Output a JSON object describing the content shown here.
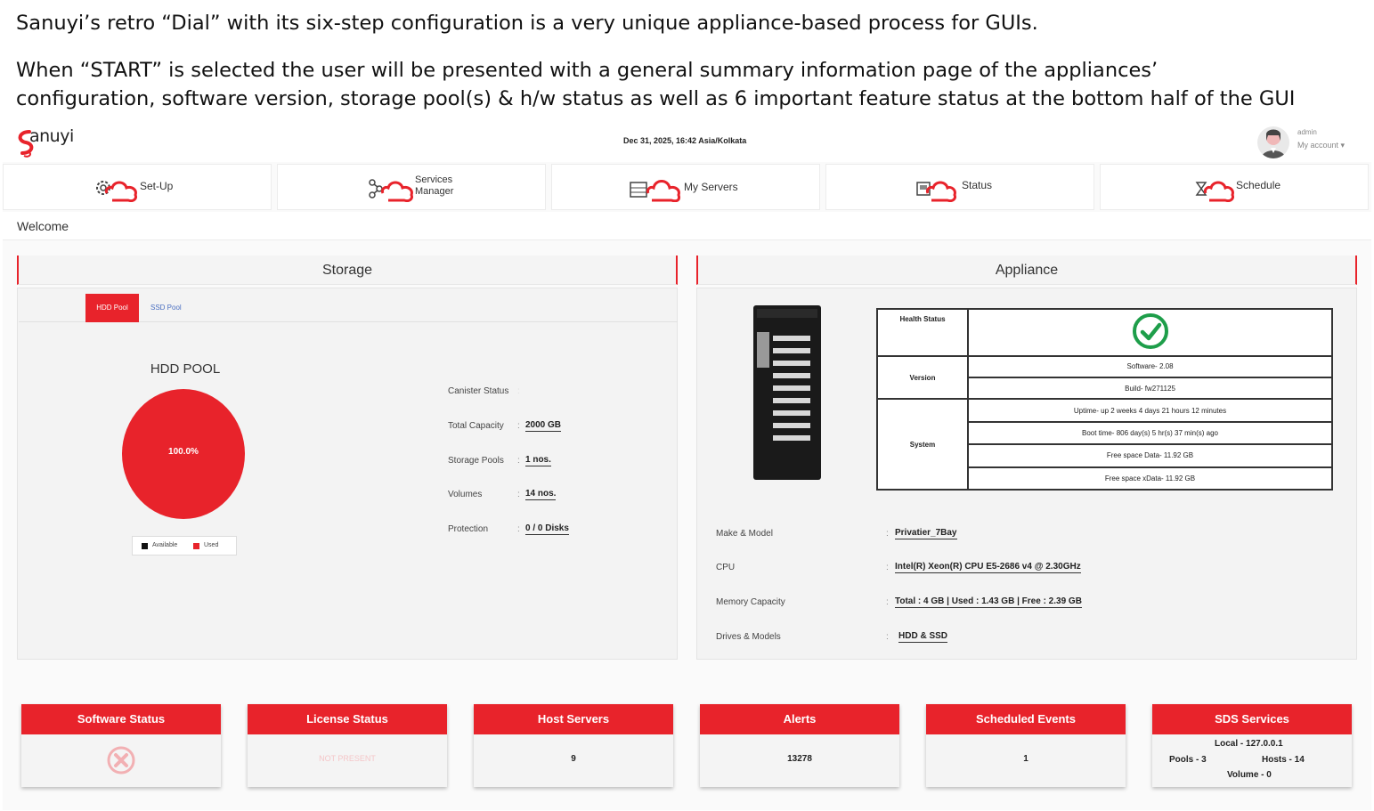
{
  "captions": [
    "Sanuyi’s retro “Dial” with its six-step configuration is a very unique appliance-based process for GUIs.",
    "When “START” is selected the user will be presented with a general summary information page of the appliances’",
    "configuration, software version, storage pool(s) & h/w status as well as 6 important feature status at the bottom half of the GUI"
  ],
  "header": {
    "logo": "anuyi",
    "datetime": "Dec 31, 2025, 16:42 Asia/Kolkata",
    "user": "admin",
    "account_menu": "My account ▾"
  },
  "nav": [
    {
      "label": "Set-Up",
      "icon": "gear-icon"
    },
    {
      "label_line1": "Services",
      "label_line2": "Manager",
      "icon": "network-icon"
    },
    {
      "label": "My Servers",
      "icon": "server-icon"
    },
    {
      "label": "Status",
      "icon": "monitor-icon"
    },
    {
      "label": "Schedule",
      "icon": "hourglass-icon"
    }
  ],
  "welcome": "Welcome",
  "storage": {
    "title": "Storage",
    "tabs": [
      "HDD Pool",
      "SSD Pool"
    ],
    "pool_title": "HDD POOL",
    "pie_label": "100.0%",
    "legend": [
      "Available",
      "Used"
    ],
    "stats": [
      {
        "label": "Canister Status",
        "value": ""
      },
      {
        "label": "Total Capacity",
        "value": "2000 GB"
      },
      {
        "label": "Storage Pools",
        "value": "1 nos."
      },
      {
        "label": "Volumes",
        "value": "14 nos."
      },
      {
        "label": "Protection",
        "value": "0 / 0 Disks"
      }
    ]
  },
  "chart_data": {
    "type": "pie",
    "categories": [
      "Available",
      "Used"
    ],
    "values": [
      0,
      100
    ],
    "title": "HDD POOL"
  },
  "appliance": {
    "title": "Appliance",
    "health_label": "Health Status",
    "version_label": "Version",
    "software": "Software- 2.08",
    "build": "Build- fw271125",
    "system_label": "System",
    "uptime": "Uptime- up 2 weeks 4 days 21 hours 12 minutes",
    "boot_time": "Boot time- 806 day(s) 5 hr(s) 37 min(s) ago",
    "free_data": "Free space Data- 11.92 GB",
    "free_xdata": "Free space xData- 11.92 GB",
    "details": [
      {
        "label": "Make & Model",
        "value": "Privatier_7Bay"
      },
      {
        "label": "CPU",
        "value": "Intel(R) Xeon(R) CPU E5-2686 v4 @ 2.30GHz"
      },
      {
        "label": "Memory Capacity",
        "value": "Total : 4 GB | Used : 1.43 GB | Free : 2.39 GB"
      },
      {
        "label": "Drives & Models",
        "value": "HDD & SSD"
      }
    ]
  },
  "cards": [
    {
      "title": "Software Status"
    },
    {
      "title": "License Status",
      "value": "NOT PRESENT"
    },
    {
      "title": "Host Servers",
      "value": "9"
    },
    {
      "title": "Alerts",
      "value": "13278"
    },
    {
      "title": "Scheduled Events",
      "value": "1"
    },
    {
      "title": "SDS Services",
      "local": "Local - 127.0.0.1",
      "pools": "Pools - 3",
      "hosts": "Hosts - 14",
      "volume": "Volume - 0"
    }
  ],
  "colors": {
    "accent": "#e8232b",
    "health_ok": "#1e9e4a"
  }
}
